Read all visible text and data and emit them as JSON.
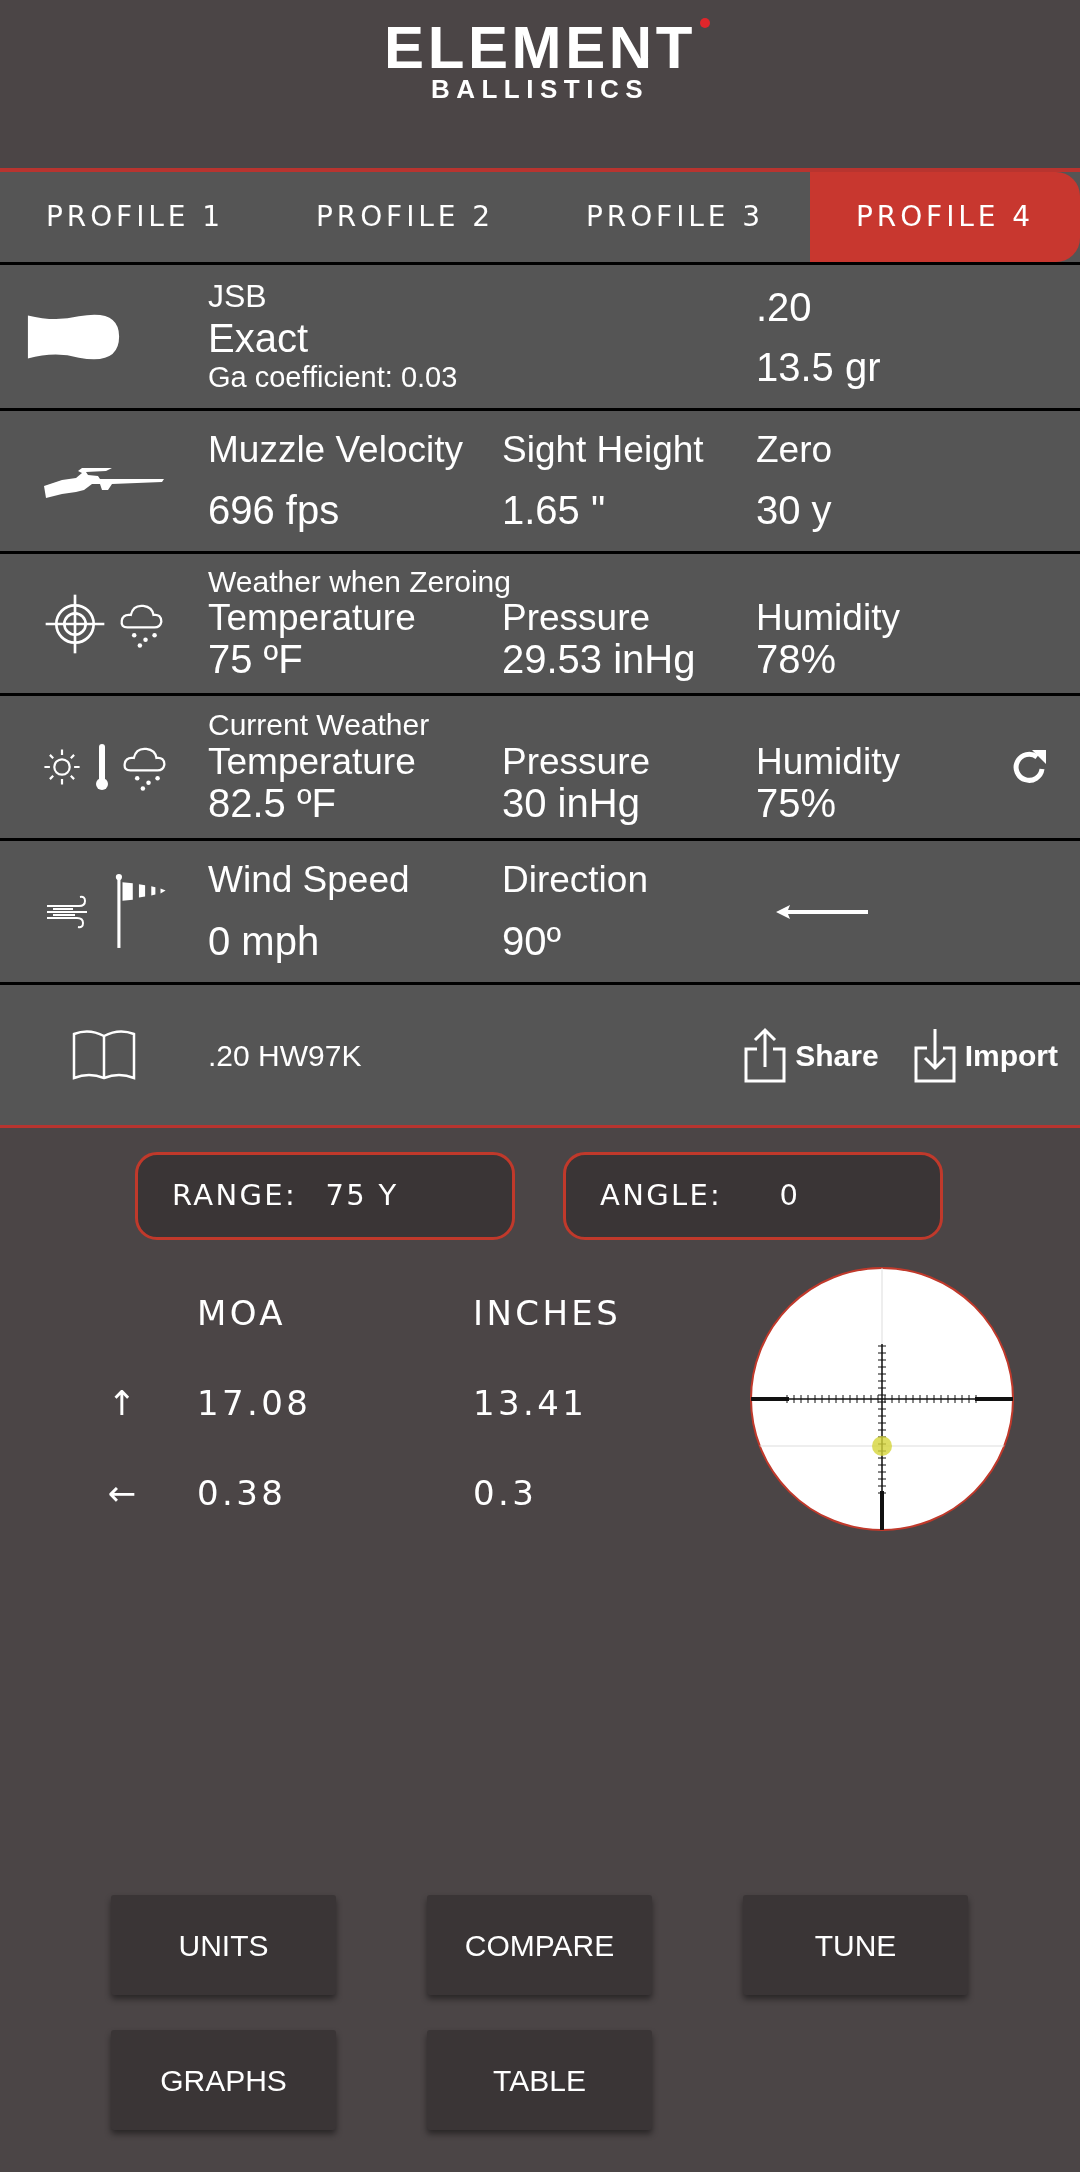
{
  "logo": {
    "title": "ELEMENT",
    "subtitle": "BALLISTICS"
  },
  "tabs": [
    {
      "label": "PROFILE 1",
      "selected": false
    },
    {
      "label": "PROFILE 2",
      "selected": false
    },
    {
      "label": "PROFILE 3",
      "selected": false
    },
    {
      "label": "PROFILE 4",
      "selected": true
    }
  ],
  "pellet": {
    "brand": "JSB",
    "name": "Exact",
    "coefficient": "Ga coefficient: 0.03",
    "caliber": ".20",
    "weight": "13.5 gr"
  },
  "rifle": {
    "fields": [
      {
        "label": "Muzzle Velocity",
        "value": "696 fps"
      },
      {
        "label": "Sight Height",
        "value": "1.65 \""
      },
      {
        "label": "Zero",
        "value": "30 y"
      }
    ]
  },
  "zero_weather": {
    "title": "Weather when Zeroing",
    "fields": [
      {
        "label": "Temperature",
        "value": "75 ºF"
      },
      {
        "label": "Pressure",
        "value": "29.53 inHg"
      },
      {
        "label": "Humidity",
        "value": "78%"
      }
    ]
  },
  "current_weather": {
    "title": "Current Weather",
    "fields": [
      {
        "label": "Temperature",
        "value": "82.5 ºF"
      },
      {
        "label": "Pressure",
        "value": "30 inHg"
      },
      {
        "label": "Humidity",
        "value": "75%"
      }
    ]
  },
  "wind": {
    "fields": [
      {
        "label": "Wind Speed",
        "value": "0 mph"
      },
      {
        "label": "Direction",
        "value": "90º"
      }
    ]
  },
  "profile": {
    "name": ".20 HW97K",
    "share": "Share",
    "import": "Import"
  },
  "range": {
    "label": "RANGE:",
    "value": "75 Y"
  },
  "angle": {
    "label": "ANGLE:",
    "value": "0"
  },
  "corrections": {
    "columns": [
      "MOA",
      "INCHES"
    ],
    "rows": [
      {
        "arrow": "↑",
        "values": [
          "17.08",
          "13.41"
        ]
      },
      {
        "arrow": "←",
        "values": [
          "0.38",
          "0.3"
        ]
      }
    ]
  },
  "buttons": [
    "UNITS",
    "COMPARE",
    "TUNE",
    "GRAPHS",
    "TABLE"
  ]
}
